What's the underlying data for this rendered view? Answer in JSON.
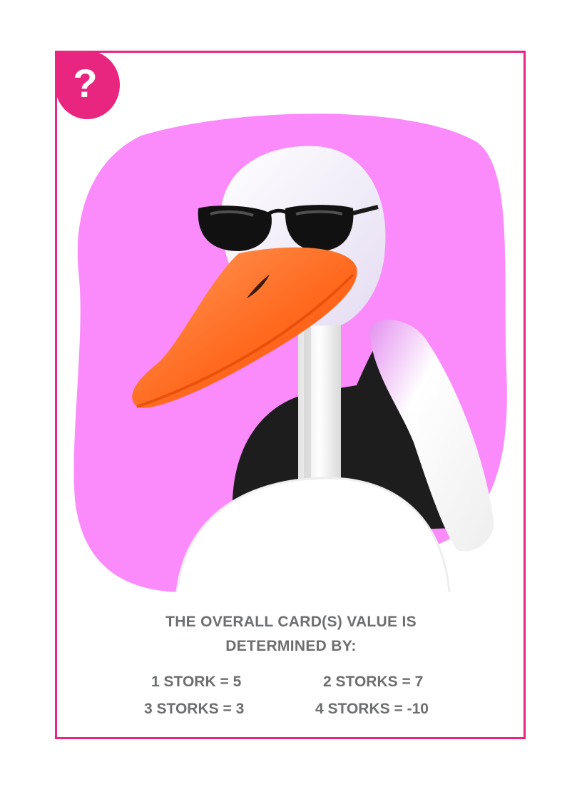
{
  "badge": {
    "symbol": "?",
    "color": "#e8257f"
  },
  "card": {
    "border_color": "#e8257f",
    "blob_color": "#fb8bfb"
  },
  "rules": {
    "heading_line1": "THE OVERALL CARD(S) VALUE IS",
    "heading_line2": "DETERMINED BY:",
    "values": [
      {
        "label": "1 STORK = 5"
      },
      {
        "label": "2 STORKS = 7"
      },
      {
        "label": "3 STORKS = 3"
      },
      {
        "label": "4 STORKS = -10"
      }
    ]
  }
}
